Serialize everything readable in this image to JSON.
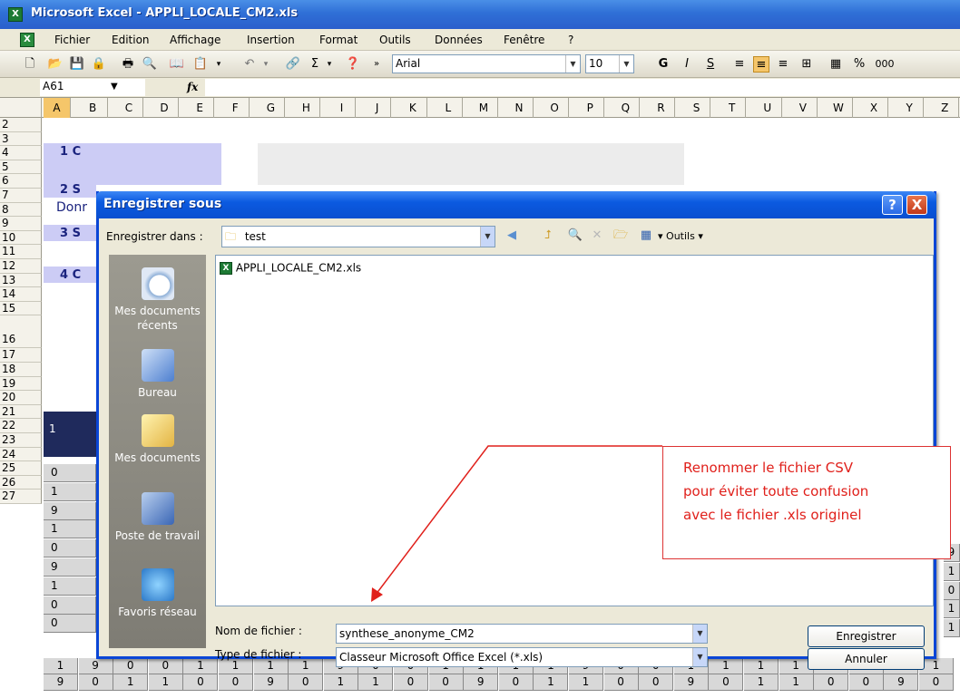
{
  "window": {
    "title": "Microsoft Excel - APPLI_LOCALE_CM2.xls"
  },
  "menu": {
    "items": [
      "Fichier",
      "Edition",
      "Affichage",
      "Insertion",
      "Format",
      "Outils",
      "Données",
      "Fenêtre",
      "?"
    ]
  },
  "toolbar": {
    "font_name": "Arial",
    "font_size": "10",
    "bold": "G",
    "italic": "I",
    "underline": "S",
    "percent": "%",
    "thousands": "000"
  },
  "formula_bar": {
    "cell_ref": "A61",
    "fx": "fx"
  },
  "columns": [
    "A",
    "B",
    "C",
    "D",
    "E",
    "F",
    "G",
    "H",
    "I",
    "J",
    "K",
    "L",
    "M",
    "N",
    "O",
    "P",
    "Q",
    "R",
    "S",
    "T",
    "U",
    "V",
    "W",
    "X",
    "Y",
    "Z"
  ],
  "rows": [
    "2",
    "3",
    "4",
    "5",
    "6",
    "7",
    "8",
    "9",
    "10",
    "11",
    "12",
    "13",
    "14",
    "15",
    "16",
    "17",
    "18",
    "19",
    "20",
    "21",
    "22",
    "23",
    "24",
    "25",
    "26",
    "27"
  ],
  "sheet": {
    "header_text": "Donr",
    "items": [
      {
        "num": "1",
        "letter": "C"
      },
      {
        "num": "2",
        "letter": "S"
      },
      {
        "num": "3",
        "letter": "S"
      },
      {
        "num": "4",
        "letter": "C"
      }
    ],
    "row16_a": "1",
    "col_a_values": [
      "0",
      "1",
      "9",
      "1",
      "0",
      "9",
      "1",
      "0",
      "0"
    ],
    "right_values": [
      "9",
      "1",
      "0",
      "1",
      "1"
    ],
    "row26": [
      "1",
      "9",
      "0",
      "0",
      "1",
      "1",
      "1",
      "1",
      "9",
      "0",
      "0",
      "1",
      "1",
      "1",
      "1",
      "9",
      "0",
      "0",
      "1",
      "1",
      "1",
      "1",
      "9",
      "0",
      "0",
      "1",
      "1",
      "1",
      "9"
    ],
    "row27": [
      "9",
      "0",
      "1",
      "1",
      "0",
      "0",
      "9",
      "0",
      "1",
      "1",
      "0",
      "0",
      "9",
      "0",
      "1",
      "1",
      "0",
      "0",
      "9",
      "0",
      "1",
      "1",
      "0",
      "0",
      "9",
      "0"
    ]
  },
  "dialog": {
    "title": "Enregistrer sous",
    "help": "?",
    "close": "X",
    "save_in_label": "Enregistrer dans :",
    "save_in_value": "test",
    "tools_label": "Outils",
    "places": [
      {
        "label": "Mes documents récents",
        "icon": "recent-documents-icon"
      },
      {
        "label": "Bureau",
        "icon": "desktop-icon"
      },
      {
        "label": "Mes documents",
        "icon": "my-documents-icon"
      },
      {
        "label": "Poste de travail",
        "icon": "my-computer-icon"
      },
      {
        "label": "Favoris réseau",
        "icon": "network-places-icon"
      }
    ],
    "files": [
      "APPLI_LOCALE_CM2.xls"
    ],
    "filename_label": "Nom de fichier :",
    "filename_value": "synthese_anonyme_CM2",
    "filetype_label": "Type de fichier :",
    "filetype_value": "Classeur Microsoft Office Excel (*.xls)",
    "save_button": "Enregistrer",
    "cancel_button": "Annuler"
  },
  "callout": {
    "lines": [
      "Renommer le fichier CSV",
      "pour éviter toute confusion",
      "avec le fichier .xls originel"
    ],
    "color": "#e0201b"
  }
}
